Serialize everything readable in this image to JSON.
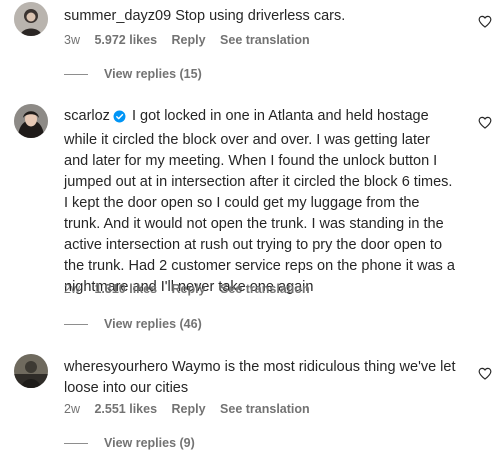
{
  "comments": [
    {
      "username": "summer_dayz09",
      "text": "Stop using driverless cars.",
      "age": "3w",
      "likes": "5.972 likes",
      "reply": "Reply",
      "translate": "See translation",
      "view_replies": "View replies (15)",
      "avatar_icon": "avatar-image",
      "like_icon": "heart-outline-icon"
    },
    {
      "username": "scarloz",
      "verified": true,
      "text": "I got locked in one in Atlanta and held hostage while it circled the block over and over. I was getting later and later for my meeting. When I found the unlock button I jumped out at in intersection after it circled the block 6 times. I kept the door open so I could get my luggage from the trunk. And it would not open the trunk. I was standing in the active intersection at rush out trying to pry the door open to the trunk. Had 2 customer service reps on the phone it was a nightmare and I'll never take one again",
      "age": "2w",
      "likes": "1.310 likes",
      "reply": "Reply",
      "translate": "See translation",
      "view_replies": "View replies (46)",
      "avatar_icon": "avatar-image",
      "like_icon": "heart-outline-icon"
    },
    {
      "username": "wheresyourhero",
      "text": "Waymo is the most ridiculous thing we've let loose into our cities",
      "age": "2w",
      "likes": "2.551 likes",
      "reply": "Reply",
      "translate": "See translation",
      "view_replies": "View replies (9)",
      "avatar_icon": "avatar-image",
      "like_icon": "heart-outline-icon"
    }
  ],
  "colors": {
    "text": "#262626",
    "secondary": "#737373",
    "verified": "#0095f6"
  }
}
